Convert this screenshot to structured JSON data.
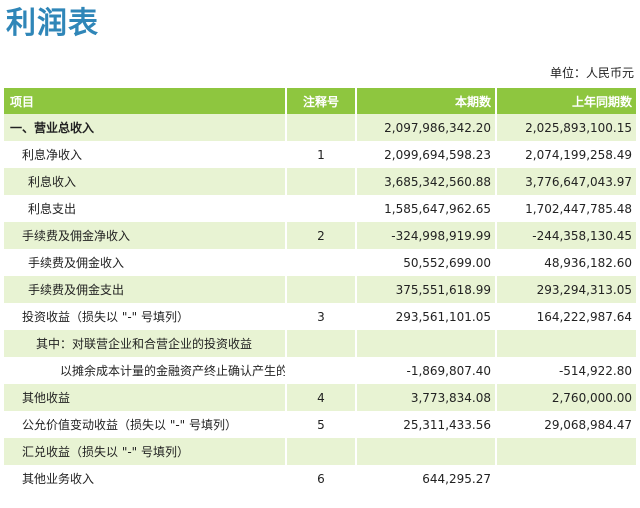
{
  "title": "利润表",
  "unit": "单位：人民币元",
  "headers": {
    "item": "项目",
    "note": "注释号",
    "current": "本期数",
    "previous": "上年同期数"
  },
  "rows": [
    {
      "item": "一、营业总收入",
      "note": "",
      "current": "2,097,986,342.20",
      "previous": "2,025,893,100.15"
    },
    {
      "item": "利息净收入",
      "note": "1",
      "current": "2,099,694,598.23",
      "previous": "2,074,199,258.49"
    },
    {
      "item": "利息收入",
      "note": "",
      "current": "3,685,342,560.88",
      "previous": "3,776,647,043.97"
    },
    {
      "item": "利息支出",
      "note": "",
      "current": "1,585,647,962.65",
      "previous": "1,702,447,785.48"
    },
    {
      "item": "手续费及佣金净收入",
      "note": "2",
      "current": "-324,998,919.99",
      "previous": "-244,358,130.45"
    },
    {
      "item": "手续费及佣金收入",
      "note": "",
      "current": "50,552,699.00",
      "previous": "48,936,182.60"
    },
    {
      "item": "手续费及佣金支出",
      "note": "",
      "current": "375,551,618.99",
      "previous": "293,294,313.05"
    },
    {
      "item": "投资收益（损失以 \"-\" 号填列）",
      "note": "3",
      "current": "293,561,101.05",
      "previous": "164,222,987.64"
    },
    {
      "item": "其中：对联营企业和合营企业的投资收益",
      "note": "",
      "current": "",
      "previous": ""
    },
    {
      "item": "以摊余成本计量的金融资产终止确认产生的收益",
      "note": "",
      "current": "-1,869,807.40",
      "previous": "-514,922.80"
    },
    {
      "item": "其他收益",
      "note": "4",
      "current": "3,773,834.08",
      "previous": "2,760,000.00"
    },
    {
      "item": "公允价值变动收益（损失以 \"-\" 号填列）",
      "note": "5",
      "current": "25,311,433.56",
      "previous": "29,068,984.47"
    },
    {
      "item": "汇兑收益（损失以 \"-\" 号填列）",
      "note": "",
      "current": "",
      "previous": ""
    },
    {
      "item": "其他业务收入",
      "note": "6",
      "current": "644,295.27",
      "previous": ""
    }
  ]
}
